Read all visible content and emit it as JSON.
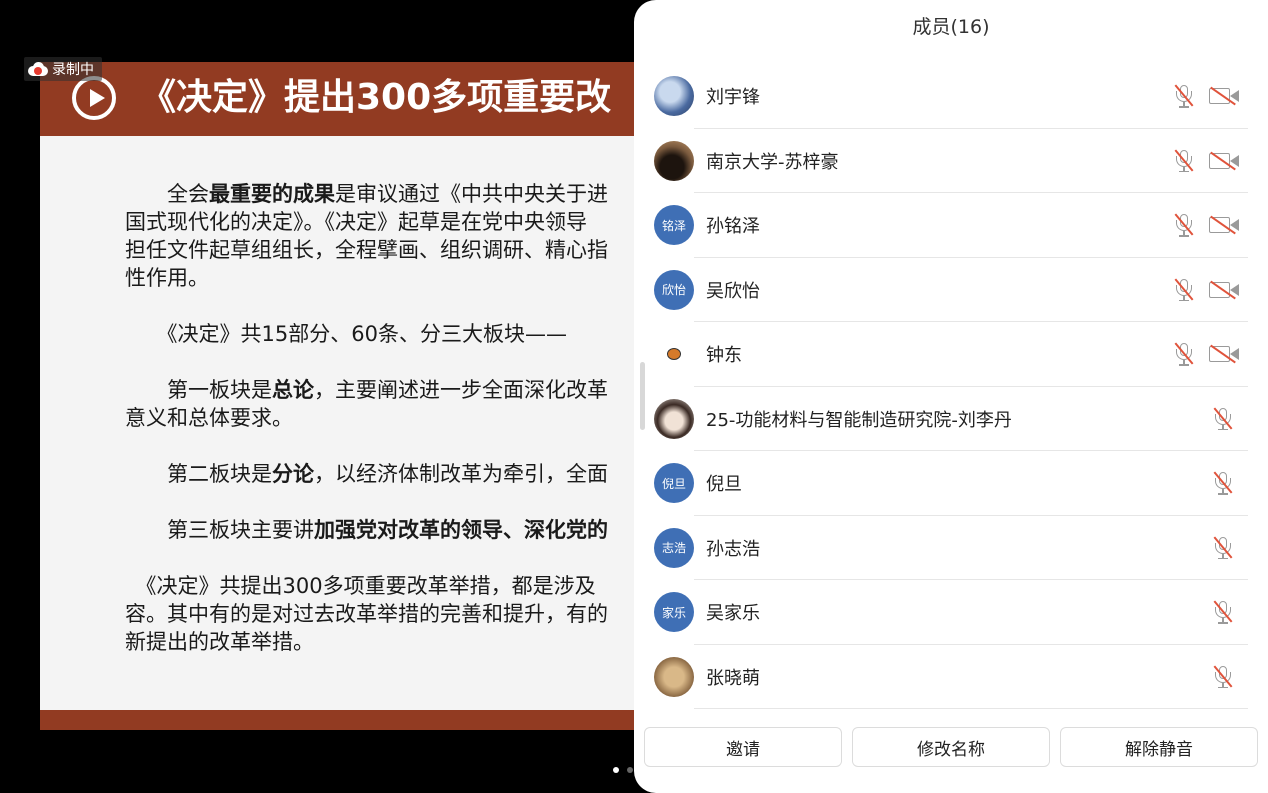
{
  "recording": {
    "label": "录制中"
  },
  "slide": {
    "title": "《决定》提出300多项重要改",
    "body": [
      [
        {
          "t": "　　全会"
        },
        {
          "t": "最重要的成果",
          "b": true
        },
        {
          "t": "是审议通过《中共中央关于进"
        }
      ],
      [
        {
          "t": "国式现代化的决定》。《决定》起草是在党中央领导"
        }
      ],
      [
        {
          "t": "担任文件起草组组长，全程擘画、组织调研、精心指"
        }
      ],
      [
        {
          "t": "性作用。"
        }
      ],
      [],
      [
        {
          "t": "　　《决定》共15部分、60条、分三大板块——"
        }
      ],
      [],
      [
        {
          "t": "　　第一板块是"
        },
        {
          "t": "总论",
          "b": true
        },
        {
          "t": "，主要阐述进一步全面深化改革"
        }
      ],
      [
        {
          "t": "意义和总体要求。"
        }
      ],
      [],
      [
        {
          "t": "　　第二板块是"
        },
        {
          "t": "分论",
          "b": true
        },
        {
          "t": "，以经济体制改革为牵引，全面"
        }
      ],
      [],
      [
        {
          "t": "　　第三板块主要讲"
        },
        {
          "t": "加强党对改革的领导、深化党的",
          "b": true
        }
      ],
      [],
      [
        {
          "t": "　《决定》共提出300多项重要改革举措，都是涉及"
        }
      ],
      [
        {
          "t": "容。其中有的是对过去改革举措的完善和提升，有的"
        }
      ],
      [
        {
          "t": "新提出的改革举措。"
        }
      ]
    ]
  },
  "panel": {
    "title": "成员(16)",
    "members": [
      {
        "name": "刘宇锋",
        "avatar": "photo-a",
        "avatar_text": "",
        "camera_off": true
      },
      {
        "name": "南京大学-苏梓豪",
        "avatar": "photo-b",
        "avatar_text": "",
        "camera_off": true
      },
      {
        "name": "孙铭泽",
        "avatar": "text",
        "avatar_text": "铭泽",
        "camera_off": true
      },
      {
        "name": "吴欣怡",
        "avatar": "text",
        "avatar_text": "欣怡",
        "camera_off": true
      },
      {
        "name": "钟东",
        "avatar": "photo-c",
        "avatar_text": "",
        "camera_off": true
      },
      {
        "name": "25-功能材料与智能制造研究院-刘李丹",
        "avatar": "photo-d",
        "avatar_text": "",
        "camera_off": false
      },
      {
        "name": "倪旦",
        "avatar": "text",
        "avatar_text": "倪旦",
        "camera_off": false
      },
      {
        "name": "孙志浩",
        "avatar": "text",
        "avatar_text": "志浩",
        "camera_off": false
      },
      {
        "name": "吴家乐",
        "avatar": "text",
        "avatar_text": "家乐",
        "camera_off": false
      },
      {
        "name": "张晓萌",
        "avatar": "photo-e",
        "avatar_text": "",
        "camera_off": false
      }
    ],
    "buttons": {
      "invite": "邀请",
      "rename": "修改名称",
      "unmute": "解除静音"
    }
  },
  "icons": {
    "mic": "mic-muted-icon",
    "camera": "camera-off-icon",
    "record": "cloud-record-icon",
    "play": "play-icon"
  },
  "colors": {
    "slide_accent": "#923b22",
    "avatar_blue": "#3f6fb5",
    "muted_red": "#e0533b"
  }
}
